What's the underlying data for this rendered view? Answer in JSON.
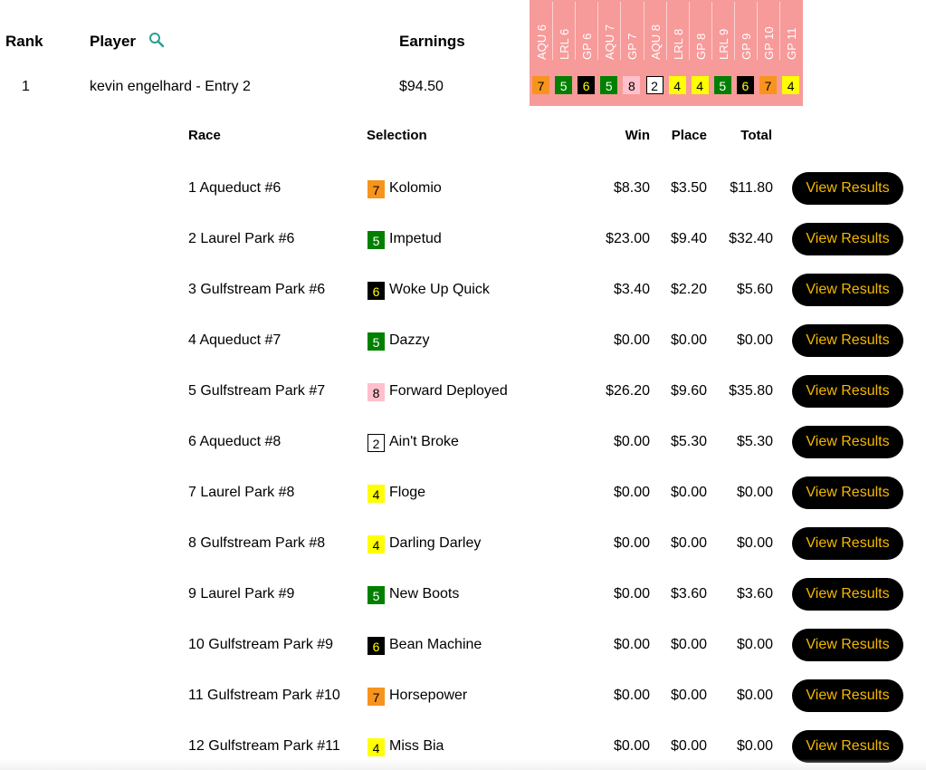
{
  "header": {
    "rank_label": "Rank",
    "player_label": "Player",
    "earnings_label": "Earnings"
  },
  "race_columns": [
    "AQU 6",
    "LRL 6",
    "GP 6",
    "AQU 7",
    "GP 7",
    "AQU 8",
    "LRL 8",
    "GP 8",
    "LRL 9",
    "GP 9",
    "GP 10",
    "GP 11"
  ],
  "entry": {
    "rank": "1",
    "player": "kevin engelhard - Entry 2",
    "earnings": "$94.50",
    "picks": [
      {
        "num": "7",
        "color": "orange"
      },
      {
        "num": "5",
        "color": "green"
      },
      {
        "num": "6",
        "color": "black"
      },
      {
        "num": "5",
        "color": "green"
      },
      {
        "num": "8",
        "color": "pink"
      },
      {
        "num": "2",
        "color": "white"
      },
      {
        "num": "4",
        "color": "yellow"
      },
      {
        "num": "4",
        "color": "yellow"
      },
      {
        "num": "5",
        "color": "green"
      },
      {
        "num": "6",
        "color": "black"
      },
      {
        "num": "7",
        "color": "orange"
      },
      {
        "num": "4",
        "color": "yellow"
      }
    ]
  },
  "detail": {
    "headers": {
      "race": "Race",
      "selection": "Selection",
      "win": "Win",
      "place": "Place",
      "total": "Total"
    },
    "button_label": "View Results",
    "rows": [
      {
        "race": "1 Aqueduct #6",
        "num": "7",
        "color": "orange",
        "horse": "Kolomio",
        "win": "$8.30",
        "place": "$3.50",
        "total": "$11.80"
      },
      {
        "race": "2 Laurel Park #6",
        "num": "5",
        "color": "green",
        "horse": "Impetud",
        "win": "$23.00",
        "place": "$9.40",
        "total": "$32.40"
      },
      {
        "race": "3 Gulfstream Park #6",
        "num": "6",
        "color": "black",
        "horse": "Woke Up Quick",
        "win": "$3.40",
        "place": "$2.20",
        "total": "$5.60"
      },
      {
        "race": "4 Aqueduct #7",
        "num": "5",
        "color": "green",
        "horse": "Dazzy",
        "win": "$0.00",
        "place": "$0.00",
        "total": "$0.00"
      },
      {
        "race": "5 Gulfstream Park #7",
        "num": "8",
        "color": "pink",
        "horse": "Forward Deployed",
        "win": "$26.20",
        "place": "$9.60",
        "total": "$35.80"
      },
      {
        "race": "6 Aqueduct #8",
        "num": "2",
        "color": "white",
        "horse": "Ain't Broke",
        "win": "$0.00",
        "place": "$5.30",
        "total": "$5.30"
      },
      {
        "race": "7 Laurel Park #8",
        "num": "4",
        "color": "yellow",
        "horse": "Floge",
        "win": "$0.00",
        "place": "$0.00",
        "total": "$0.00"
      },
      {
        "race": "8 Gulfstream Park #8",
        "num": "4",
        "color": "yellow",
        "horse": "Darling Darley",
        "win": "$0.00",
        "place": "$0.00",
        "total": "$0.00"
      },
      {
        "race": "9 Laurel Park #9",
        "num": "5",
        "color": "green",
        "horse": "New Boots",
        "win": "$0.00",
        "place": "$3.60",
        "total": "$3.60"
      },
      {
        "race": "10 Gulfstream Park #9",
        "num": "6",
        "color": "black",
        "horse": "Bean Machine",
        "win": "$0.00",
        "place": "$0.00",
        "total": "$0.00"
      },
      {
        "race": "11 Gulfstream Park #10",
        "num": "7",
        "color": "orange",
        "horse": "Horsepower",
        "win": "$0.00",
        "place": "$0.00",
        "total": "$0.00"
      },
      {
        "race": "12 Gulfstream Park #11",
        "num": "4",
        "color": "yellow",
        "horse": "Miss Bia",
        "win": "$0.00",
        "place": "$0.00",
        "total": "$0.00"
      }
    ]
  },
  "colors": {
    "panel": "#f79a9a",
    "button_bg": "#000000",
    "button_text": "#f5b800",
    "search_icon": "#2a9d8f",
    "saddle": {
      "orange": {
        "bg": "#f7941d",
        "fg": "#000000",
        "border": "#f7941d"
      },
      "green": {
        "bg": "#008000",
        "fg": "#ffffff",
        "border": "#008000"
      },
      "black": {
        "bg": "#000000",
        "fg": "#ffff00",
        "border": "#000000"
      },
      "pink": {
        "bg": "#ffc0cb",
        "fg": "#000000",
        "border": "#ffc0cb"
      },
      "white": {
        "bg": "#ffffff",
        "fg": "#000000",
        "border": "#000000"
      },
      "yellow": {
        "bg": "#ffff00",
        "fg": "#000000",
        "border": "#ffff00"
      }
    }
  },
  "icons": {
    "search": "search-icon"
  }
}
